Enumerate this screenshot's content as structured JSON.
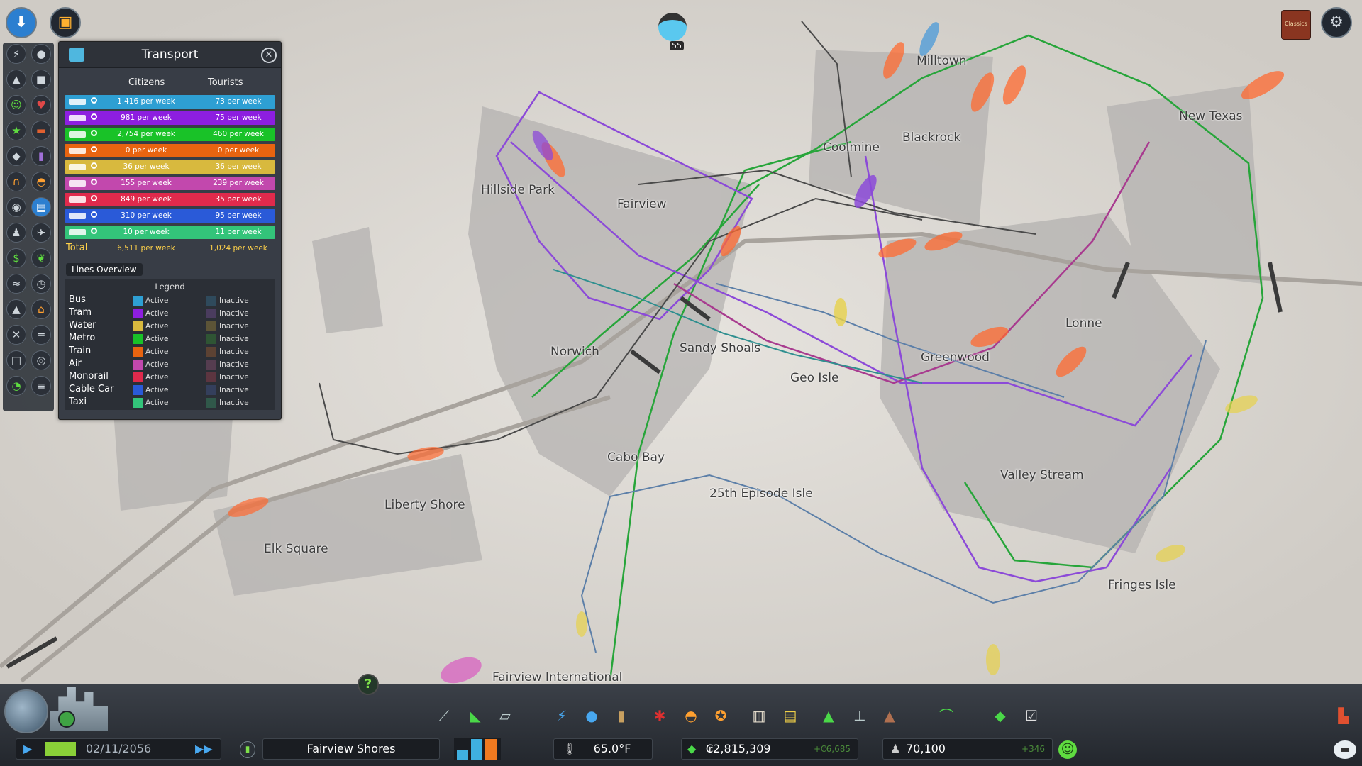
{
  "top": {
    "notification_count": "55"
  },
  "transport_panel": {
    "title": "Transport",
    "col_citizens": "Citizens",
    "col_tourists": "Tourists",
    "rows": [
      {
        "mode": "Bus",
        "citizens": "1,416 per week",
        "tourists": "73 per week",
        "color": "#2e9fd3"
      },
      {
        "mode": "Tram",
        "citizens": "981 per week",
        "tourists": "75 per week",
        "color": "#8d1ee0"
      },
      {
        "mode": "Metro",
        "citizens": "2,754 per week",
        "tourists": "460 per week",
        "color": "#19c228"
      },
      {
        "mode": "Train",
        "citizens": "0 per week",
        "tourists": "0 per week",
        "color": "#e86410"
      },
      {
        "mode": "Water",
        "citizens": "36 per week",
        "tourists": "36 per week",
        "color": "#d8b93e"
      },
      {
        "mode": "Air",
        "citizens": "155 per week",
        "tourists": "239 per week",
        "color": "#c248ad"
      },
      {
        "mode": "Monorail",
        "citizens": "849 per week",
        "tourists": "35 per week",
        "color": "#e02a4c"
      },
      {
        "mode": "Cable Car",
        "citizens": "310 per week",
        "tourists": "95 per week",
        "color": "#2a5ad8"
      },
      {
        "mode": "Taxi",
        "citizens": "10 per week",
        "tourists": "11 per week",
        "color": "#33c47a"
      }
    ],
    "total_label": "Total",
    "total_citizens": "6,511 per week",
    "total_tourists": "1,024 per week",
    "lines_overview": "Lines Overview",
    "legend_title": "Legend",
    "legend": [
      {
        "name": "Bus",
        "active_color": "#2e9fd3",
        "inactive_color": "#2f4a5c"
      },
      {
        "name": "Tram",
        "active_color": "#8d1ee0",
        "inactive_color": "#4a3c5e"
      },
      {
        "name": "Water",
        "active_color": "#d8b93e",
        "inactive_color": "#5c5437"
      },
      {
        "name": "Metro",
        "active_color": "#19c228",
        "inactive_color": "#2f5534"
      },
      {
        "name": "Train",
        "active_color": "#e86410",
        "inactive_color": "#5c4233"
      },
      {
        "name": "Air",
        "active_color": "#c248ad",
        "inactive_color": "#553d50"
      },
      {
        "name": "Monorail",
        "active_color": "#e02a4c",
        "inactive_color": "#5c3540"
      },
      {
        "name": "Cable Car",
        "active_color": "#2a5ad8",
        "inactive_color": "#343f5c"
      },
      {
        "name": "Taxi",
        "active_color": "#33c47a",
        "inactive_color": "#30584a"
      }
    ],
    "active_label": "Active",
    "inactive_label": "Inactive"
  },
  "map_labels": [
    "Milltown",
    "New Texas",
    "Coolmine",
    "Blackrock",
    "Hillside Park",
    "Fairview",
    "Lonne",
    "Greenwood",
    "Norwich",
    "Sandy Shoals",
    "Geo Isle",
    "Cabo Bay",
    "Valley Stream",
    "25th Episode Isle",
    "Liberty Shore",
    "Elk Square",
    "Fringes Isle",
    "Fairview International"
  ],
  "bottom": {
    "date": "02/11/2056",
    "city_name": "Fairview Shores",
    "temperature": "65.0°F",
    "money": "₢2,815,309",
    "income": "+₢6,685",
    "population": "70,100",
    "pop_change": "+346"
  }
}
